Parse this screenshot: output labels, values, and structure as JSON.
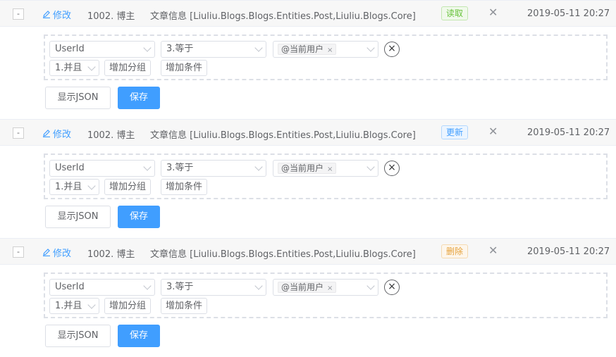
{
  "rows": [
    {
      "collapse": "-",
      "edit": "修改",
      "user": "1002. 博主",
      "entity": "文章信息 [Liuliu.Blogs.Blogs.Entities.Post,Liuliu.Blogs.Core]",
      "operation": "读取",
      "close": "✕",
      "time": "2019-05-11 20:27",
      "filter": {
        "field": "UserId",
        "operator": "3.等于",
        "value_chip": "@当前用户",
        "chip_remove": "×",
        "remove_condition": "×",
        "logic": "1.并且",
        "add_group": "增加分组",
        "add_condition": "增加条件"
      },
      "show_json": "显示JSON",
      "save": "保存"
    },
    {
      "collapse": "-",
      "edit": "修改",
      "user": "1002. 博主",
      "entity": "文章信息 [Liuliu.Blogs.Blogs.Entities.Post,Liuliu.Blogs.Core]",
      "operation": "更新",
      "close": "✕",
      "time": "2019-05-11 20:27",
      "filter": {
        "field": "UserId",
        "operator": "3.等于",
        "value_chip": "@当前用户",
        "chip_remove": "×",
        "remove_condition": "×",
        "logic": "1.并且",
        "add_group": "增加分组",
        "add_condition": "增加条件"
      },
      "show_json": "显示JSON",
      "save": "保存"
    },
    {
      "collapse": "-",
      "edit": "修改",
      "user": "1002. 博主",
      "entity": "文章信息 [Liuliu.Blogs.Blogs.Entities.Post,Liuliu.Blogs.Core]",
      "operation": "删除",
      "close": "✕",
      "time": "2019-05-11 20:27",
      "filter": {
        "field": "UserId",
        "operator": "3.等于",
        "value_chip": "@当前用户",
        "chip_remove": "×",
        "remove_condition": "×",
        "logic": "1.并且",
        "add_group": "增加分组",
        "add_condition": "增加条件"
      },
      "show_json": "显示JSON",
      "save": "保存"
    }
  ],
  "colors": {
    "primary": "#409eff",
    "read": "#67c23a",
    "update": "#409eff",
    "delete": "#e6a23c"
  }
}
